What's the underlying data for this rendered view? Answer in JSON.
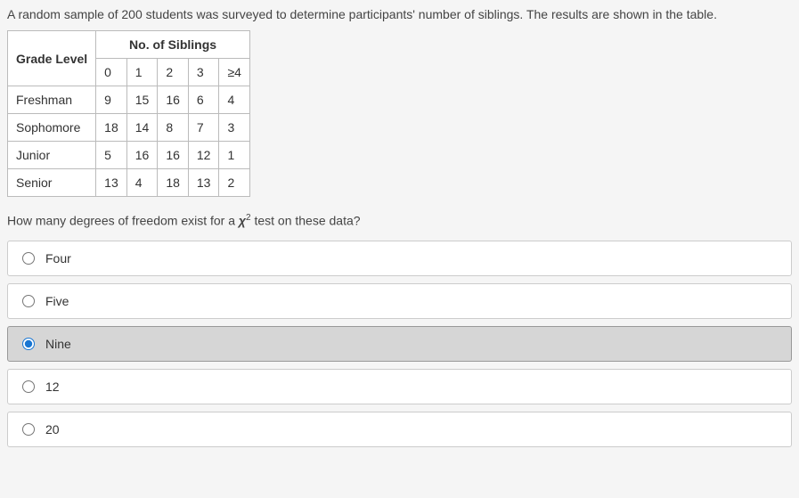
{
  "question": {
    "intro": "A random sample of 200 students was surveyed to determine participants' number of siblings. The results are shown in the table.",
    "prompt_prefix": "How many degrees of freedom exist for a ",
    "prompt_chi": "χ",
    "prompt_sup": "2",
    "prompt_suffix": " test on these data?"
  },
  "table": {
    "header_left": "Grade Level",
    "header_right": "No. of Siblings",
    "sub_headers": [
      "0",
      "1",
      "2",
      "3",
      "≥4"
    ],
    "rows": [
      {
        "label": "Freshman",
        "values": [
          "9",
          "15",
          "16",
          "6",
          "4"
        ]
      },
      {
        "label": "Sophomore",
        "values": [
          "18",
          "14",
          "8",
          "7",
          "3"
        ]
      },
      {
        "label": "Junior",
        "values": [
          "5",
          "16",
          "16",
          "12",
          "1"
        ]
      },
      {
        "label": "Senior",
        "values": [
          "13",
          "4",
          "18",
          "13",
          "2"
        ]
      }
    ]
  },
  "options": [
    {
      "label": "Four",
      "selected": false
    },
    {
      "label": "Five",
      "selected": false
    },
    {
      "label": "Nine",
      "selected": true
    },
    {
      "label": "12",
      "selected": false
    },
    {
      "label": "20",
      "selected": false
    }
  ]
}
